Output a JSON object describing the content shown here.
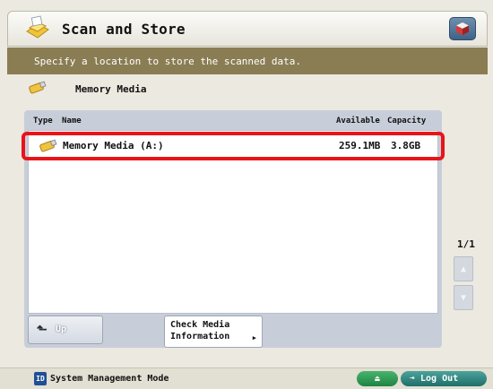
{
  "header": {
    "title": "Scan and Store"
  },
  "instruction": "Specify a location to store the scanned data.",
  "location": {
    "label": "Memory Media"
  },
  "list": {
    "columns": {
      "type": "Type",
      "name": "Name",
      "available": "Available",
      "capacity": "Capacity"
    },
    "rows": [
      {
        "name": "Memory Media (A:)",
        "available": "259.1MB",
        "capacity": "3.8GB",
        "selected": true
      }
    ]
  },
  "buttons": {
    "up": "Up",
    "check_media_line1": "Check Media",
    "check_media_line2": "Information"
  },
  "paging": {
    "indicator": "1/1"
  },
  "status": {
    "mode_icon": "ID",
    "mode_label": "System Management Mode",
    "logout": "Log Out"
  },
  "icons": {
    "app": "scan-and-store-icon",
    "media": "memory-media-icon",
    "corner": "cube-icon",
    "up": "up-arrow-icon",
    "eject": "eject-icon",
    "logout": "logout-icon"
  },
  "colors": {
    "instruction_bar": "#8a7d53",
    "selection_highlight": "#e8141a",
    "panel": "#c8ced9"
  }
}
